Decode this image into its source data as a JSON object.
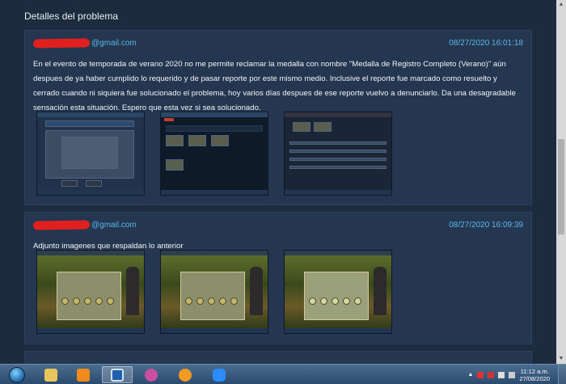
{
  "section": {
    "title": "Detalles del problema"
  },
  "messages": [
    {
      "email_suffix": "@gmail.com",
      "date": "08/27/2020 16:01:18",
      "text": "En el evento de temporada de verano 2020 no me permite reclamar la medalla con nombre \"Medalla de Registro Completo (Verano)\" aún despues de ya haber cumplido lo requerido y de pasar reporte por este mismo medio. Inclusive el reporte fue marcado como resuelto y cerrado cuando ni siquiera fue solucionado el problema, hoy varios días despues de ese reporte vuelvo a denunciarlo. Da una desagradable sensación esta situación. Espero que esta vez si sea solucionado."
    },
    {
      "email_suffix": "@gmail.com",
      "date": "08/27/2020 16:09:39",
      "text": "Adjunto imagenes que respaldan lo anterior"
    }
  ],
  "taskbar": {
    "time": "11:12 a.m.",
    "date": "27/08/2020",
    "icons": [
      "windows-start-icon",
      "folder-icon",
      "media-player-icon",
      "browser-icon",
      "snipping-tool-icon",
      "settings-icon",
      "zoom-icon"
    ]
  }
}
